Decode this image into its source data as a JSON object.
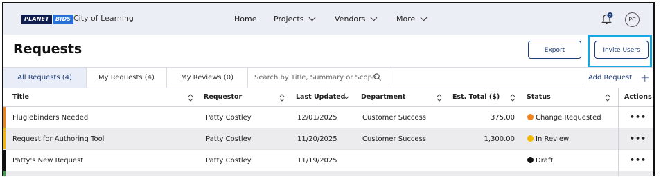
{
  "nav": {
    "logo_left": "PLANET",
    "logo_right": "BIDS",
    "org_name": "City of Learning",
    "items": [
      {
        "label": "Home"
      },
      {
        "label": "Projects"
      },
      {
        "label": "Vendors"
      },
      {
        "label": "More"
      }
    ],
    "notification_count": "2",
    "avatar_initials": "PC"
  },
  "page": {
    "title": "Requests",
    "export_label": "Export",
    "invite_label": "Invite Users"
  },
  "tabs": [
    {
      "label": "All Requests (4)",
      "active": true
    },
    {
      "label": "My Requests (4)",
      "active": false
    },
    {
      "label": "My Reviews (0)",
      "active": false
    }
  ],
  "search": {
    "placeholder": "Search by Title, Summary or Scope"
  },
  "add_request_label": "Add Request",
  "table": {
    "columns": [
      "Title",
      "Requestor",
      "Last Updated",
      "Department",
      "Est. Total ($)",
      "Status",
      "Actions"
    ],
    "rows": [
      {
        "title": "Fluglebinders Needed",
        "requestor": "Patty Costley",
        "updated": "12/01/2025",
        "department": "Customer Success",
        "total": "375.00",
        "status": "Change Requested",
        "status_color": "#f0821e",
        "stripe_color": "#f0821e"
      },
      {
        "title": "Request for Authoring Tool",
        "requestor": "Patty Costley",
        "updated": "11/20/2025",
        "department": "Customer Success",
        "total": "1,300.00",
        "status": "In Review",
        "status_color": "#f5b800",
        "stripe_color": "#f5b800"
      },
      {
        "title": "Patty's New Request",
        "requestor": "Patty Costley",
        "updated": "11/19/2025",
        "department": "",
        "total": "",
        "status": "Draft",
        "status_color": "#111111",
        "stripe_color": "#111111"
      }
    ],
    "actions_label": "•••"
  }
}
